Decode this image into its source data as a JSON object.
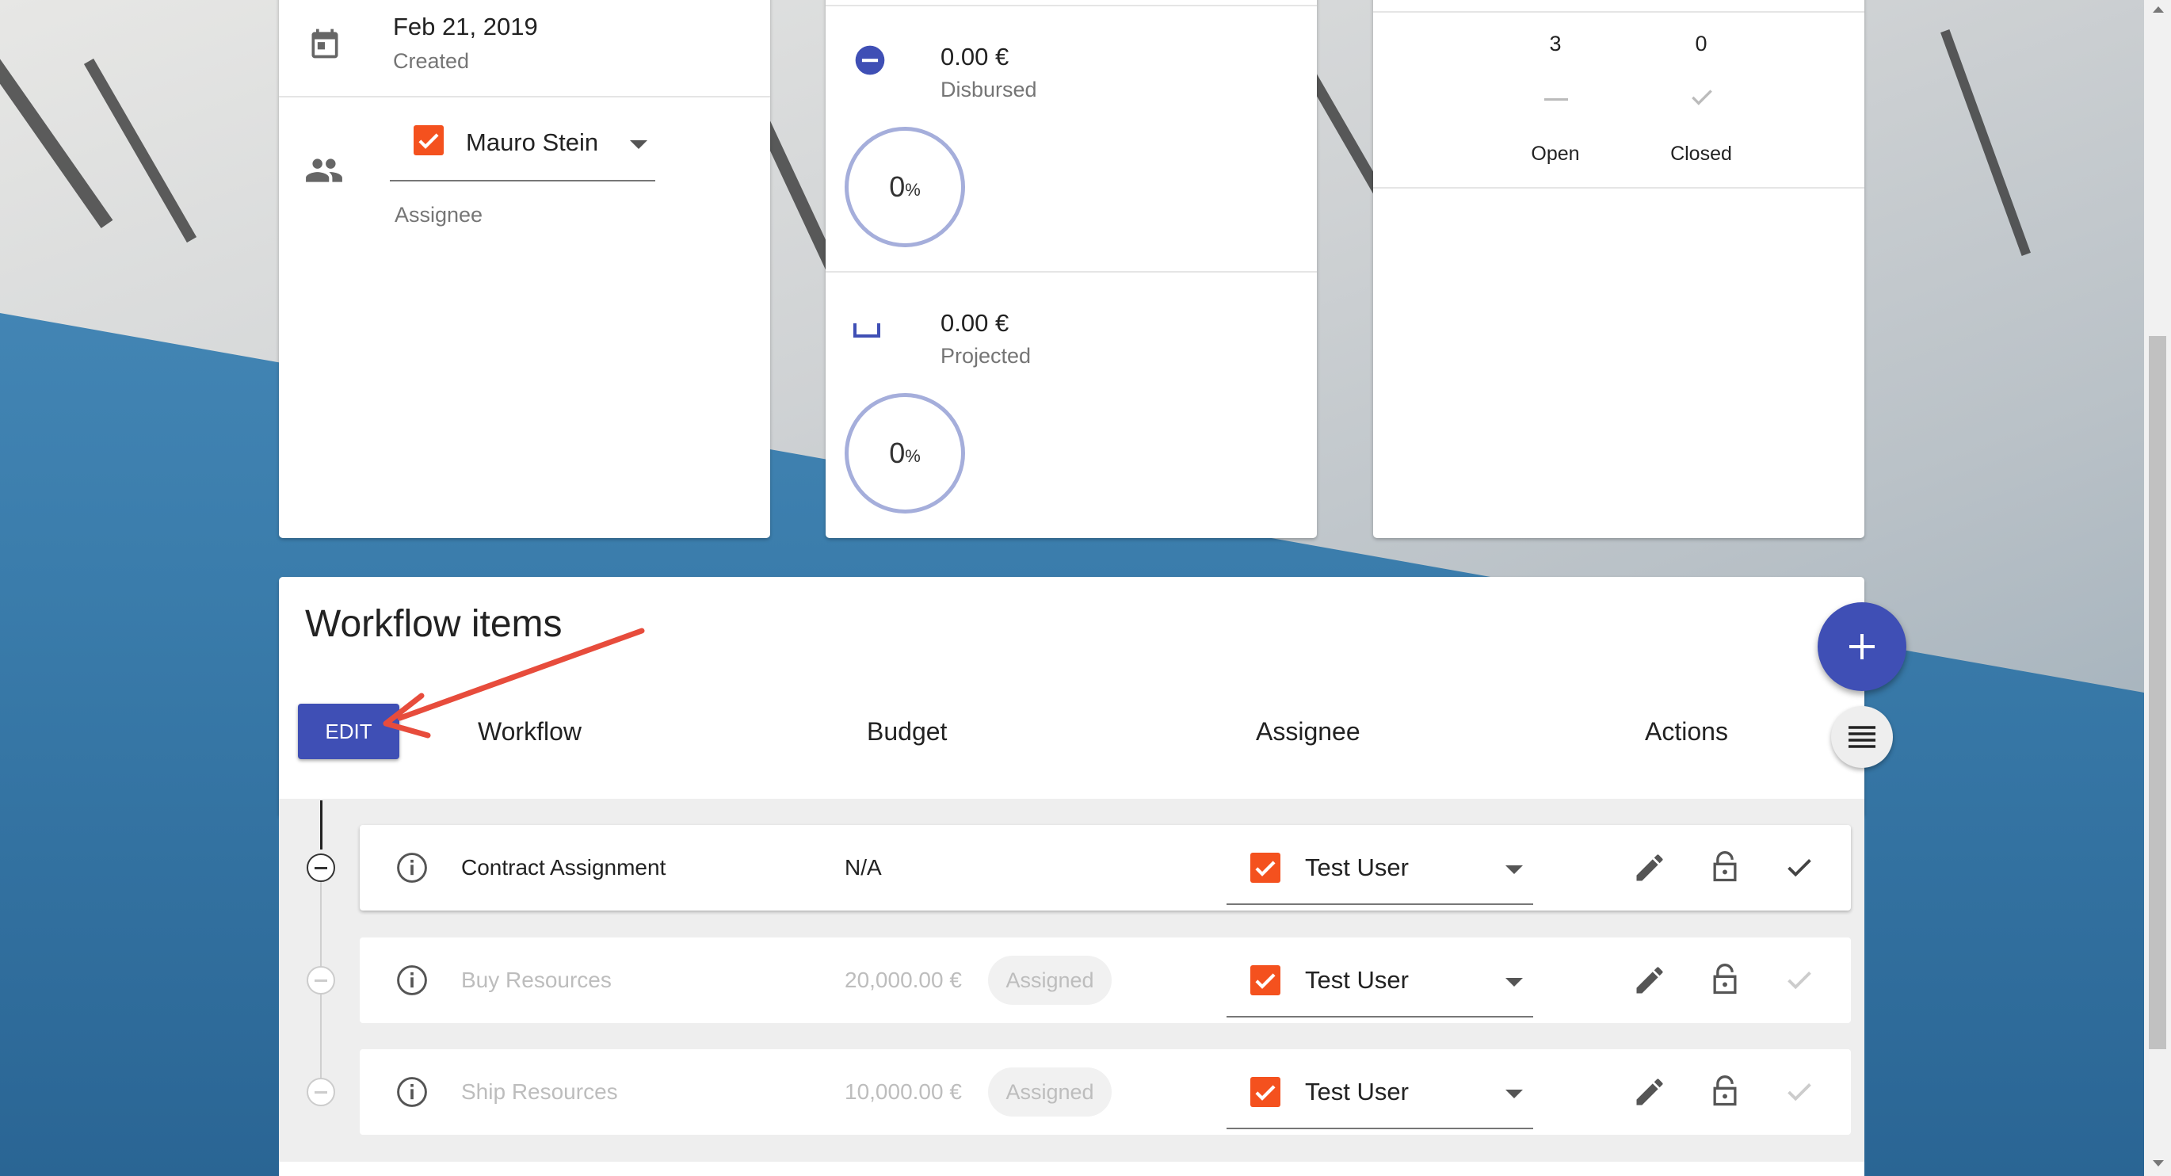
{
  "details": {
    "created_date": "Feb 21, 2019",
    "created_label": "Created",
    "assignee_name": "Mauro Stein",
    "assignee_label": "Assignee"
  },
  "budget": {
    "disbursed_amount": "0.00 €",
    "disbursed_label": "Disbursed",
    "disbursed_percent": "0",
    "projected_amount": "0.00 €",
    "projected_label": "Projected",
    "projected_percent": "0",
    "percent_sign": "%"
  },
  "status": {
    "open_count": "3",
    "closed_count": "0",
    "open_label": "Open",
    "closed_label": "Closed"
  },
  "workflow": {
    "title": "Workflow items",
    "edit_label": "EDIT",
    "headers": {
      "workflow": "Workflow",
      "budget": "Budget",
      "assignee": "Assignee",
      "actions": "Actions"
    },
    "items": [
      {
        "name": "Contract Assignment",
        "budget": "N/A",
        "assignee": "Test User",
        "status": ""
      },
      {
        "name": "Buy Resources",
        "budget": "20,000.00 €",
        "assignee": "Test User",
        "status": "Assigned"
      },
      {
        "name": "Ship Resources",
        "budget": "10,000.00 €",
        "assignee": "Test User",
        "status": "Assigned"
      }
    ]
  },
  "colors": {
    "primary": "#3f4fb5",
    "checkbox": "#f4511e",
    "ring": "#a5aedb",
    "annotation_arrow": "#e74c3c"
  },
  "icons": [
    "calendar-icon",
    "people-icon",
    "remove-circle-icon",
    "projected-icon",
    "check-icon",
    "plus-icon",
    "list-icon",
    "info-icon",
    "edit-icon",
    "lock-icon"
  ]
}
